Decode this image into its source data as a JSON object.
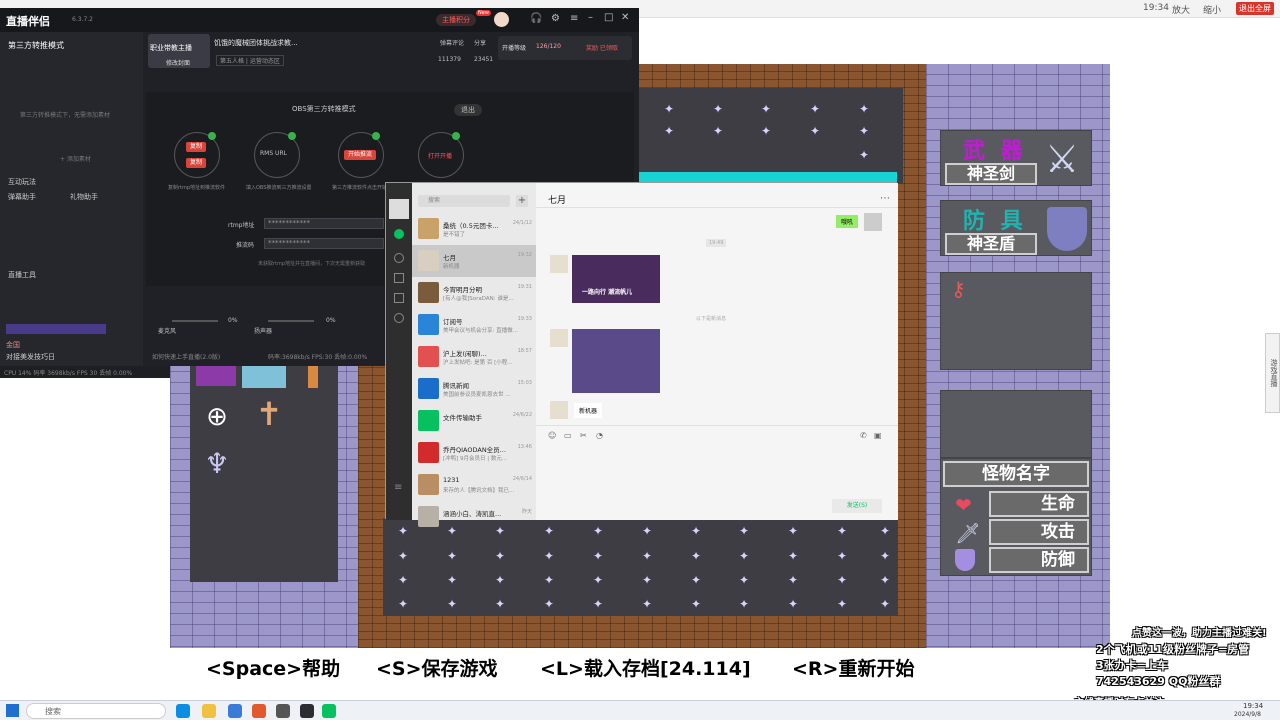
{
  "browser": {
    "right_items": [
      "19:34",
      "放大",
      "缩小"
    ],
    "exit_button": "退出全屏"
  },
  "stream_app": {
    "title": "直播伴侣",
    "version": "6.3.7.2",
    "mode": "第三方转推模式",
    "category_label": "职业带教主播",
    "category_sub": "修改封面",
    "stream_title": "饥饿的魔械团体挑战求教...",
    "room_tag": "第五人格 | 运营动态区",
    "counters": [
      "弹幕评论",
      "分享"
    ],
    "viewers": "111379",
    "likes": "23451",
    "level_label": "开播等级",
    "level_value": "126/120",
    "reward_label": "奖励 已领取",
    "header_btn": "主播积分",
    "badge_new": "New",
    "obs_title": "OBS第三方转推模式",
    "exit_btn": "退出",
    "steps": [
      "复制",
      "RMS URL",
      "开始推流",
      "打开开播"
    ],
    "step_desc": [
      "复制rtmp地址到推流软件",
      "填入OBS推流到三方推流设置",
      "第三方推流软件点击开始推流",
      ""
    ],
    "rtmp_label": "rtmp地址",
    "rtmp_value": "************",
    "key_label": "推流码",
    "key_value": "************",
    "hint": "未获取rtmp地址并在直播间，下次无需重新获取",
    "mic_label": "麦克风",
    "mic_val": "0%",
    "speaker_label": "扬声器",
    "speaker_val": "0%",
    "bottom_hint": "如何快速上手直播(2.0版)",
    "status_bar": "码率:3698kb/s  FPS:30  丢帧:0.00%",
    "side_items": [
      "互动玩法",
      "弹幕助手",
      "礼物助手",
      "直播工具"
    ],
    "side_empty": "第三方转推模式下，无需添加素材",
    "side_add": "+ 添加素材",
    "chat_users": [
      "金国",
      "对接美发技巧日"
    ],
    "cpu": "CPU 14%  码率 3698kb/s  FPS 30  丢帧 0.00%"
  },
  "wechat": {
    "search_placeholder": "搜索",
    "chat_title": "七月",
    "contacts": [
      {
        "name": "桑统（0.5元团卡...",
        "preview": "是不错了",
        "time": "24/1/12"
      },
      {
        "name": "七月",
        "preview": "新机器",
        "time": "19:32"
      },
      {
        "name": "今宵明月分明",
        "preview": "[有人@我]SoraDAN: 谁是...",
        "time": "19:31"
      },
      {
        "name": "订阅号",
        "preview": "美甲会议与机会分享: 直播做...",
        "time": "19:33"
      },
      {
        "name": "沪上发(闲聊)...",
        "preview": "沪上发帖吧: 是第 百 [小程...",
        "time": "18:57"
      },
      {
        "name": "腾讯新闻",
        "preview": "美国前参议员麦凯恩去世 ...",
        "time": "15:03"
      },
      {
        "name": "文件传输助手",
        "preview": "",
        "time": "24/6/22"
      },
      {
        "name": "乔丹QIAODAN全员...",
        "preview": "[冲鸭] 9月会员日 | 数元...",
        "time": "13:46"
      },
      {
        "name": "1231",
        "preview": "来存的人【腾讯文档】我已...",
        "time": "24/6/14"
      },
      {
        "name": "涵涵小白、涛凯直...",
        "preview": "",
        "time": "昨天"
      }
    ],
    "time_chip": "19:49",
    "divider": "以下是新消息",
    "bubble_green": "哦吼",
    "img1_caption": "一路向行 潮流帆儿",
    "last_msg": "新机器",
    "send_btn": "发送(S)"
  },
  "game": {
    "weapon_label": "武  器",
    "weapon_name": "神圣剑",
    "armor_label": "防  具",
    "armor_name": "神圣盾",
    "monster_name": "怪物名字",
    "hp_label": "生命",
    "atk_label": "攻击",
    "def_label": "防御",
    "bottom_help": [
      "<Space>帮助",
      "<S>保存游戏",
      "<L>载入存档[24.114]",
      "<R>重新开始"
    ]
  },
  "overlay": {
    "line0": "点赞这一波，助力主播过难关!",
    "line1": "2个飞机或11级粉丝牌子=房管",
    "line2": "3张办卡=上车",
    "line3": "742543629  QQ粉丝群",
    "line4": "主线直播时有点关注"
  },
  "side_tab": "游戏直播",
  "taskbar": {
    "search": "搜索",
    "time": "19:34",
    "date": "2024/9/8"
  }
}
